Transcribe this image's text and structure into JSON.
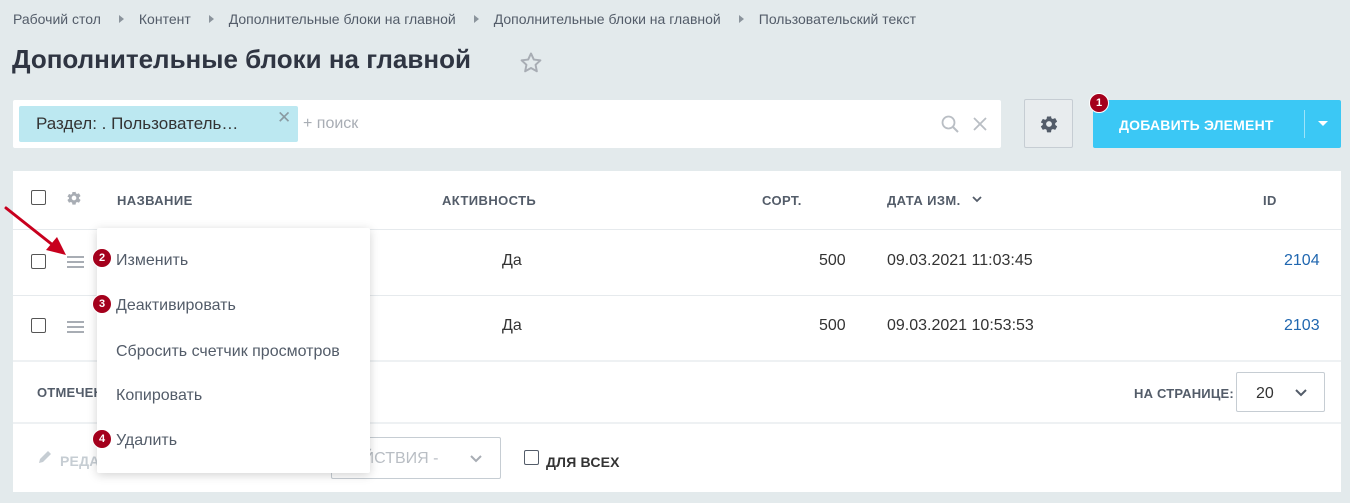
{
  "breadcrumbs": [
    "Рабочий стол",
    "Контент",
    "Дополнительные блоки на главной",
    "Дополнительные блоки на главной",
    "Пользовательский текст"
  ],
  "page_title": "Дополнительные блоки на главной",
  "filter": {
    "chip_label": "Раздел: . Пользователь…",
    "search_placeholder": "+ поиск"
  },
  "add_button": {
    "label": "ДОБАВИТЬ ЭЛЕМЕНТ"
  },
  "grid": {
    "columns": {
      "name": "НАЗВАНИЕ",
      "active": "АКТИВНОСТЬ",
      "sort": "СОРТ.",
      "date": "ДАТА ИЗМ.",
      "id": "ID"
    },
    "rows": [
      {
        "active": "Да",
        "sort": "500",
        "date": "09.03.2021 11:03:45",
        "id": "2104"
      },
      {
        "active": "Да",
        "sort": "500",
        "date": "09.03.2021 10:53:53",
        "id": "2103"
      }
    ],
    "footer": {
      "selected_label": "ОТМЕЧЕН",
      "per_page_label": "НА СТРАНИЦЕ:",
      "per_page_value": "20"
    },
    "actions": {
      "edit_label": "РЕДА",
      "select_value": "ЕЙСТВИЯ -",
      "for_all_label": "ДЛЯ ВСЕХ"
    }
  },
  "context_menu": {
    "items": [
      "Изменить",
      "Деактивировать",
      "Сбросить счетчик просмотров",
      "Копировать",
      "Удалить"
    ]
  },
  "badges": [
    "1",
    "2",
    "3",
    "4"
  ],
  "colors": {
    "accent": "#3bc8f5",
    "badge": "#a4001c",
    "link": "#2067b0",
    "chip": "#bce8f1",
    "arrow": "#c8001e"
  },
  "icons": [
    "star-icon",
    "search-icon",
    "clear-icon",
    "gear-icon",
    "hamburger-icon",
    "pencil-icon",
    "chevron-down-icon"
  ]
}
